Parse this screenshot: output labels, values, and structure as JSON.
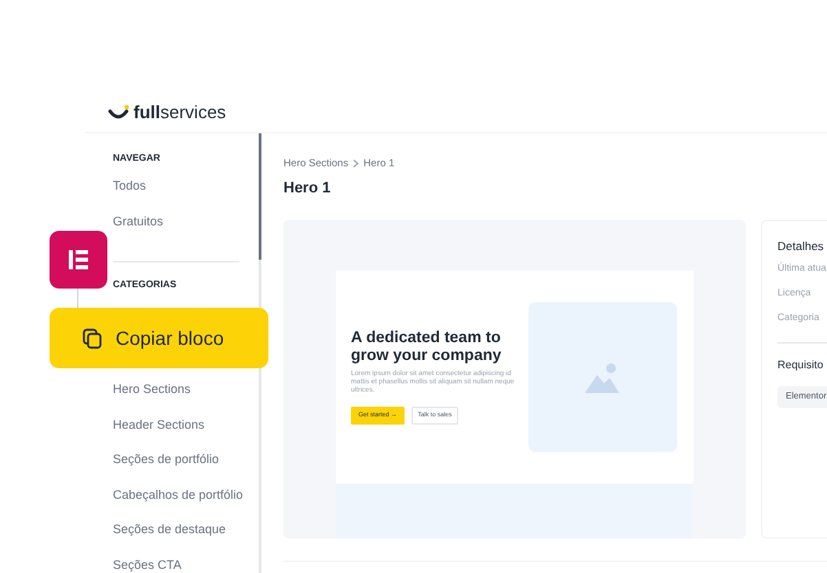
{
  "logo": {
    "bold": "full",
    "light": "services"
  },
  "sidebar": {
    "sections": [
      {
        "title": "NAVEGAR",
        "items": [
          "Todos",
          "Gratuitos"
        ]
      },
      {
        "title": "CATEGORIAS",
        "items": [
          "Hero Sections",
          "Header Sections",
          "Seções de portfólio",
          "Cabeçalhos de portfólio",
          "Seções de destaque",
          "Seções CTA"
        ]
      }
    ]
  },
  "overlay": {
    "copy_button": "Copiar bloco"
  },
  "breadcrumb": [
    "Hero Sections",
    "Hero 1"
  ],
  "title": "Hero 1",
  "preview": {
    "heading": "A dedicated team to grow your company",
    "body": "Lorem ipsum dolor sit amet consectetur adipiscing id mattis et phasellus mollis sit aliquam sit nullam neque ultrices.",
    "primary_button": "Get started →",
    "secondary_button": "Talk to sales"
  },
  "details": {
    "title": "Detalhes",
    "rows": [
      "Última atua",
      "Licença",
      "Categoria"
    ],
    "requirements_title": "Requisito",
    "tags": [
      "Elementor"
    ]
  }
}
